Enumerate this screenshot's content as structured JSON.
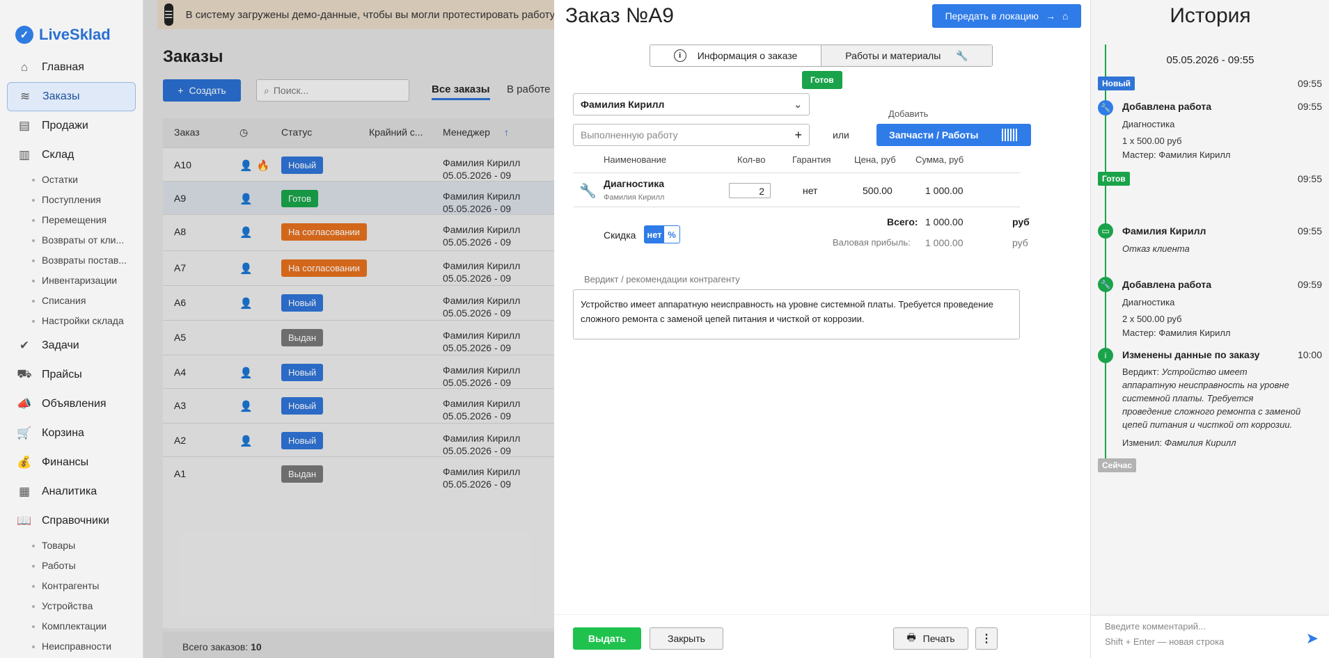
{
  "app": {
    "name": "LiveSklad"
  },
  "sidebar": {
    "items": [
      {
        "label": "Главная",
        "icon": "home-icon"
      },
      {
        "label": "Заказы",
        "icon": "layers-icon",
        "active": true
      },
      {
        "label": "Продажи",
        "icon": "register-icon"
      },
      {
        "label": "Склад",
        "icon": "warehouse-icon"
      }
    ],
    "warehouse_sub": [
      "Остатки",
      "Поступления",
      "Перемещения",
      "Возвраты от кли...",
      "Возвраты постав...",
      "Инвентаризации",
      "Списания",
      "Настройки склада"
    ],
    "items2": [
      {
        "label": "Задачи",
        "icon": "check-icon"
      },
      {
        "label": "Прайсы",
        "icon": "truck-icon"
      },
      {
        "label": "Объявления",
        "icon": "megaphone-icon"
      },
      {
        "label": "Корзина",
        "icon": "basket-icon"
      },
      {
        "label": "Финансы",
        "icon": "money-icon"
      },
      {
        "label": "Аналитика",
        "icon": "chart-icon"
      },
      {
        "label": "Справочники",
        "icon": "book-icon"
      }
    ],
    "ref_sub": [
      "Товары",
      "Работы",
      "Контрагенты",
      "Устройства",
      "Комплектации",
      "Неисправности"
    ]
  },
  "banner": {
    "text": "В систему загружены демо-данные, чтобы вы могли протестировать работу"
  },
  "orders": {
    "title": "Заказы",
    "create_label": "Создать",
    "search_placeholder": "Поиск...",
    "tab_all": "Все заказы",
    "tab_work": "В работе",
    "columns": {
      "order": "Заказ",
      "status": "Статус",
      "deadline": "Крайний с...",
      "manager": "Менеджер"
    },
    "rows": [
      {
        "id": "A10",
        "status": "Новый",
        "kind": "new",
        "mgr": "Фамилия Кирилл",
        "date": "05.05.2026 - 09",
        "fire": true
      },
      {
        "id": "A9",
        "status": "Готов",
        "kind": "ready",
        "mgr": "Фамилия Кирилл",
        "date": "05.05.2026 - 09",
        "selected": true
      },
      {
        "id": "A8",
        "status": "На согласовании",
        "kind": "agree",
        "mgr": "Фамилия Кирилл",
        "date": "05.05.2026 - 09"
      },
      {
        "id": "A7",
        "status": "На согласовании",
        "kind": "agree",
        "mgr": "Фамилия Кирилл",
        "date": "05.05.2026 - 09"
      },
      {
        "id": "A6",
        "status": "Новый",
        "kind": "new",
        "mgr": "Фамилия Кирилл",
        "date": "05.05.2026 - 09"
      },
      {
        "id": "A5",
        "status": "Выдан",
        "kind": "out",
        "mgr": "Фамилия Кирилл",
        "date": "05.05.2026 - 09",
        "noicon": true
      },
      {
        "id": "A4",
        "status": "Новый",
        "kind": "new",
        "mgr": "Фамилия Кирилл",
        "date": "05.05.2026 - 09"
      },
      {
        "id": "A3",
        "status": "Новый",
        "kind": "new",
        "mgr": "Фамилия Кирилл",
        "date": "05.05.2026 - 09"
      },
      {
        "id": "A2",
        "status": "Новый",
        "kind": "new",
        "mgr": "Фамилия Кирилл",
        "date": "05.05.2026 - 09"
      },
      {
        "id": "A1",
        "status": "Выдан",
        "kind": "out",
        "mgr": "Фамилия Кирилл",
        "date": "05.05.2026 - 09",
        "noicon": true
      }
    ],
    "footer_label": "Всего заказов:",
    "footer_count": "10"
  },
  "modal": {
    "title": "Заказ №A9",
    "transfer_label": "Передать в локацию",
    "tab_info": "Информация о заказе",
    "tab_works": "Работы и материалы",
    "status": "Готов",
    "master": "Фамилия Кирилл",
    "work_placeholder": "Выполненную работу",
    "or": "или",
    "add_label": "Добавить",
    "parts_label": "Запчасти / Работы",
    "cols": {
      "name": "Наименование",
      "qty": "Кол-во",
      "warranty": "Гарантия",
      "price": "Цена, руб",
      "sum": "Сумма, руб"
    },
    "item": {
      "name": "Диагностика",
      "master": "Фамилия Кирилл",
      "qty": "2",
      "warranty": "нет",
      "price": "500.00",
      "sum": "1 000.00"
    },
    "total_label": "Всего:",
    "total_value": "1 000.00",
    "currency": "руб",
    "profit_label": "Валовая прибыль:",
    "profit_value": "1 000.00",
    "discount_label": "Скидка",
    "discount_no": "нет",
    "discount_pct": "%",
    "verdict_label": "Вердикт / рекомендации контрагенту",
    "verdict_text": "Устройство имеет аппаратную неисправность на уровне системной платы. Требуется проведение сложного ремонта с заменой цепей питания и чисткой от коррозии.",
    "issue_label": "Выдать",
    "close_label": "Закрыть",
    "print_label": "Печать"
  },
  "history": {
    "title": "История",
    "date": "05.05.2026 - 09:55",
    "badge_new": "Новый",
    "t1": "09:55",
    "e1_head": "Добавлена работа",
    "e1_time": "09:55",
    "e1_l1": "Диагностика",
    "e1_l2": "1 x 500.00 руб",
    "e1_l3": "Мастер: Фамилия Кирилл",
    "badge_ready": "Готов",
    "t2": "09:55",
    "e2_head": "Фамилия Кирилл",
    "e2_time": "09:55",
    "e2_text": "Отказ клиента",
    "e3_head": "Добавлена работа",
    "e3_time": "09:59",
    "e3_l1": "Диагностика",
    "e3_l2": "2 x 500.00 руб",
    "e3_l3": "Мастер: Фамилия Кирилл",
    "e4_head": "Изменены данные по заказу",
    "e4_time": "10:00",
    "e4_verdict_label": "Вердикт:",
    "e4_verdict": "Устройство имеет аппаратную неисправность на уровне системной платы. Требуется проведение сложного ремонта с заменой цепей питания и чисткой от коррозии.",
    "e4_changed_label": "Изменил:",
    "e4_changed": "Фамилия Кирилл",
    "badge_now": "Сейчас",
    "comment_placeholder": "Введите комментарий...",
    "comment_hint": "Shift + Enter — новая строка"
  }
}
